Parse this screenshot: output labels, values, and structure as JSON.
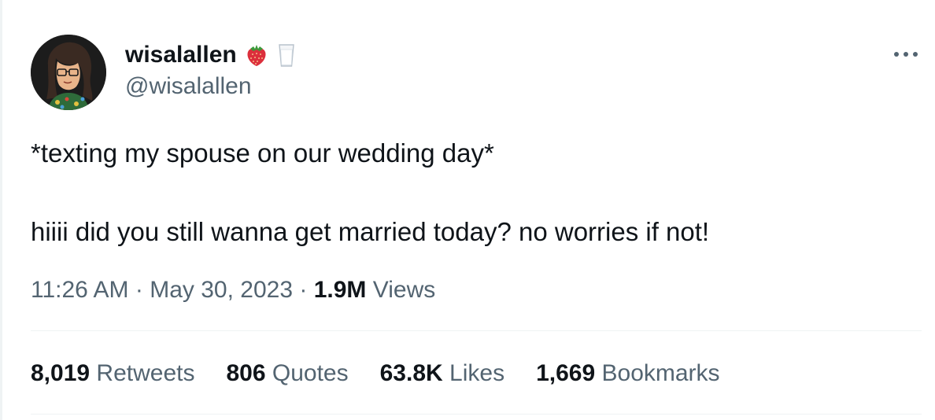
{
  "author": {
    "display_name": "wisalallen",
    "handle": "@wisalallen",
    "name_emojis": [
      "strawberry-icon",
      "milk-glass-icon"
    ]
  },
  "tweet": {
    "line1": "*texting my spouse on our wedding day*",
    "line2": "hiiii did you still wanna get married today? no worries if not!"
  },
  "meta": {
    "time": "11:26 AM",
    "separator": "·",
    "date": "May 30, 2023",
    "views_count": "1.9M",
    "views_label": "Views"
  },
  "stats": {
    "retweets_count": "8,019",
    "retweets_label": "Retweets",
    "quotes_count": "806",
    "quotes_label": "Quotes",
    "likes_count": "63.8K",
    "likes_label": "Likes",
    "bookmarks_count": "1,669",
    "bookmarks_label": "Bookmarks"
  },
  "colors": {
    "text_primary": "#0f1419",
    "text_secondary": "#536471",
    "divider": "#eff3f4"
  }
}
